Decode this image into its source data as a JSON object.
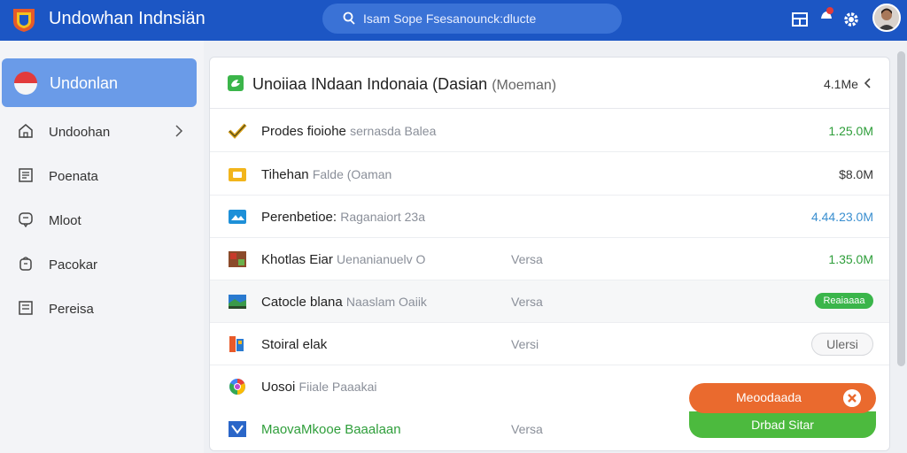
{
  "app": {
    "title": "Undowhan Indnsiän",
    "search_placeholder": "Isam Sope Fsesanounck:dlucte"
  },
  "header_icons": [
    "grid-icon",
    "notification-icon",
    "gear-icon",
    "user-avatar"
  ],
  "sidebar": {
    "active": {
      "label": "Undonlan",
      "icon": "flag-icon"
    },
    "items": [
      {
        "label": "Undoohan",
        "icon": "home-icon",
        "has_chevron": true
      },
      {
        "label": "Poenata",
        "icon": "document-icon"
      },
      {
        "label": "Mloot",
        "icon": "chat-icon"
      },
      {
        "label": "Pacokar",
        "icon": "package-icon"
      },
      {
        "label": "Pereisa",
        "icon": "list-icon"
      }
    ]
  },
  "panel": {
    "title": "Unoiiaa INdaan Indonaia (Dasian",
    "title_suffix": "(Moeman)",
    "meta": "4.1Me",
    "rows": [
      {
        "name": "Prodes fioiohe",
        "sub": "sernasda Balea",
        "version": "",
        "size": "1.25.0M",
        "size_color": "#2e9e3a",
        "icon": "check-icon",
        "icon_color": "#e2a41c"
      },
      {
        "name": "Tihehan",
        "sub": "Falde (Oaman",
        "version": "",
        "size": "$8.0M",
        "size_color": "#333333",
        "icon": "folder-icon",
        "icon_color": "#f2b51c"
      },
      {
        "name": "Perenbetioe:",
        "sub": "Raganaiort 23a",
        "version": "",
        "size": "4.44.23.0M",
        "size_color": "#3a8fd0",
        "icon": "image-icon",
        "icon_color": "#1e90d8"
      },
      {
        "name": "Khotlas Eiar",
        "sub": "Uenanianuelv  O",
        "version": "Versa",
        "size": "1.35.0M",
        "size_color": "#2e9e3a",
        "icon": "photo-icon",
        "icon_color": "#8b4a2a"
      },
      {
        "name": "Catocle blana",
        "sub": "Naaslam Oaiik",
        "version": "Versa",
        "badge": "Reaiaaaa",
        "icon": "landscape-icon",
        "icon_color": "#3a9a4a",
        "highlighted": true
      },
      {
        "name": "Stoiral elak",
        "sub": "",
        "version": "Versi",
        "button": "Ulersi",
        "icon": "app-icon",
        "icon_color": "#e85a2a"
      },
      {
        "name": "Uosoi",
        "sub": "Fiiale Paaakai",
        "version": "",
        "icon": "chrome-icon",
        "icon_color": "#4285f4"
      },
      {
        "name": "MaovaMkooe Baaalaan",
        "sub": "",
        "version": "Versa",
        "name_color": "#2e9e3a",
        "icon": "vscode-icon",
        "icon_color": "#2a66c8"
      }
    ]
  },
  "toast": {
    "top_label": "Meoodaada",
    "bottom_label": "Drbad Sitar"
  },
  "colors": {
    "header": "#1c56c4",
    "accent_green": "#3ab54a",
    "accent_orange": "#ea6a2e"
  }
}
